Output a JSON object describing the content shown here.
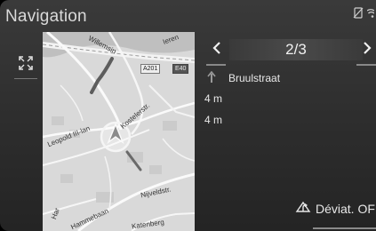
{
  "header": {
    "title": "Navigation"
  },
  "status_icons": [
    "no-signal-icon",
    "wifi-icon"
  ],
  "map": {
    "labels": {
      "street_top": "Willemsin",
      "street_top_right": "Ieren",
      "road_a201": "A201",
      "road_e40": "E40",
      "street_leopold": "Leopold III-lan",
      "street_koste": "Kostelerstr.",
      "street_nijveld": "Nijveldstr.",
      "street_katenberg": "Katenberg",
      "street_bottom_left": "Hammebaan",
      "street_bottom_left2": "Har"
    }
  },
  "route_list": {
    "pager_text": "2/3",
    "steps": [
      {
        "distance": "",
        "street": "Bruulstraat"
      },
      {
        "distance": "4 m",
        "street": ""
      },
      {
        "distance": "4 m",
        "street": ""
      }
    ]
  },
  "deviation_button": {
    "label": "Déviat. OFF"
  }
}
